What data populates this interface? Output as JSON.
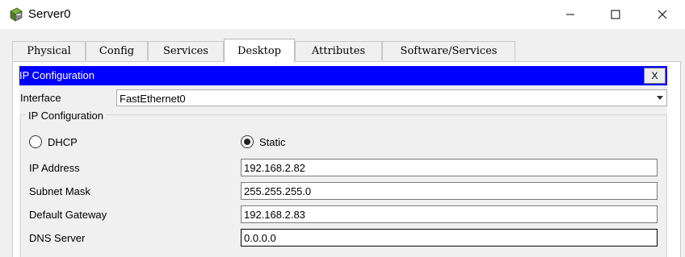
{
  "window": {
    "title": "Server0"
  },
  "tabs": [
    {
      "label": "Physical"
    },
    {
      "label": "Config"
    },
    {
      "label": "Services"
    },
    {
      "label": "Desktop"
    },
    {
      "label": "Attributes"
    },
    {
      "label": "Software/Services"
    }
  ],
  "active_tab": "Desktop",
  "ip_configuration": {
    "header_title": "IP Configuration",
    "close_label": "X",
    "interface_label": "Interface",
    "interface_value": "FastEthernet0",
    "group_title": "IP Configuration",
    "dhcp_label": "DHCP",
    "static_label": "Static",
    "mode_selected": "Static",
    "fields": [
      {
        "label": "IP Address",
        "value": "192.168.2.82"
      },
      {
        "label": "Subnet Mask",
        "value": "255.255.255.0"
      },
      {
        "label": "Default Gateway",
        "value": "192.168.2.83"
      },
      {
        "label": "DNS Server",
        "value": "0.0.0.0"
      }
    ]
  },
  "colors": {
    "header_bg": "#0000ff",
    "header_text": "#ffffff"
  },
  "icons": {
    "app": "router-cube-icon",
    "minimize": "minimize-icon",
    "maximize": "maximize-icon",
    "close": "close-icon"
  }
}
